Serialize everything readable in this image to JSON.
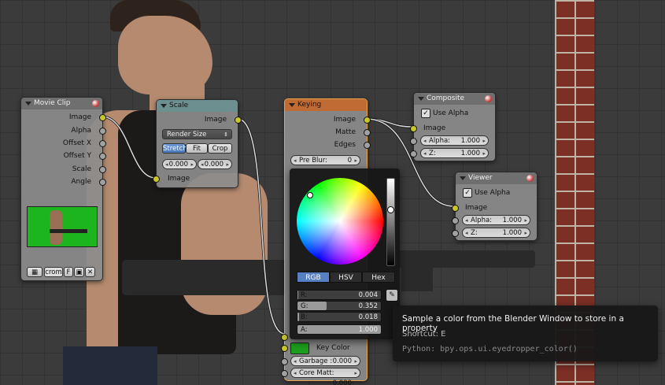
{
  "colors": {
    "accent_selected": "#5680c2",
    "socket_image": "#c7c729",
    "socket_value": "#a1a1a1",
    "active_node_border": "#e8a449",
    "key_color_swatch": "#1b9e1b"
  },
  "movie_clip": {
    "title": "Movie Clip",
    "outputs": [
      "Image",
      "Alpha",
      "Offset X",
      "Offset Y",
      "Scale",
      "Angle"
    ],
    "clip_name": "crom",
    "fake_user": "F",
    "icons": [
      "clip-browse-icon",
      "image-icon",
      "close-icon"
    ]
  },
  "scale": {
    "title": "Scale",
    "output": "Image",
    "mode": "Render Size",
    "frame_buttons": [
      "Stretch",
      "Fit",
      "Crop"
    ],
    "frame_selected": 0,
    "offset_x": "0.000",
    "offset_y": "0.000",
    "input": "Image"
  },
  "keying": {
    "title": "Keying",
    "outputs": [
      "Image",
      "Matte",
      "Edges"
    ],
    "pre_blur_label": "Pre Blur:",
    "pre_blur_value": "0",
    "key_color_label": "Key Color",
    "garbage_label": "Garbage :",
    "garbage_value": "0.000",
    "core_label": "Core Matt:",
    "core_value": "0.000"
  },
  "composite": {
    "title": "Composite",
    "use_alpha": "Use Alpha",
    "input": "Image",
    "alpha_label": "Alpha:",
    "alpha_value": "1.000",
    "z_label": "Z:",
    "z_value": "1.000"
  },
  "viewer": {
    "title": "Viewer",
    "use_alpha": "Use Alpha",
    "input": "Image",
    "alpha_label": "Alpha:",
    "alpha_value": "1.000",
    "z_label": "Z:",
    "z_value": "1.000"
  },
  "picker": {
    "modes": [
      "RGB",
      "HSV",
      "Hex"
    ],
    "mode_selected": 0,
    "channels": [
      {
        "label": "R:",
        "value": "0.004",
        "fraction": 0.004
      },
      {
        "label": "G:",
        "value": "0.352",
        "fraction": 0.352
      },
      {
        "label": "B:",
        "value": "0.018",
        "fraction": 0.018
      },
      {
        "label": "A:",
        "value": "1.000",
        "fraction": 1.0
      }
    ]
  },
  "tooltip": {
    "description": "Sample a color from the Blender Window to store in a property",
    "shortcut": "Shortcut: E",
    "python": "Python: bpy.ops.ui.eyedropper_color()"
  }
}
